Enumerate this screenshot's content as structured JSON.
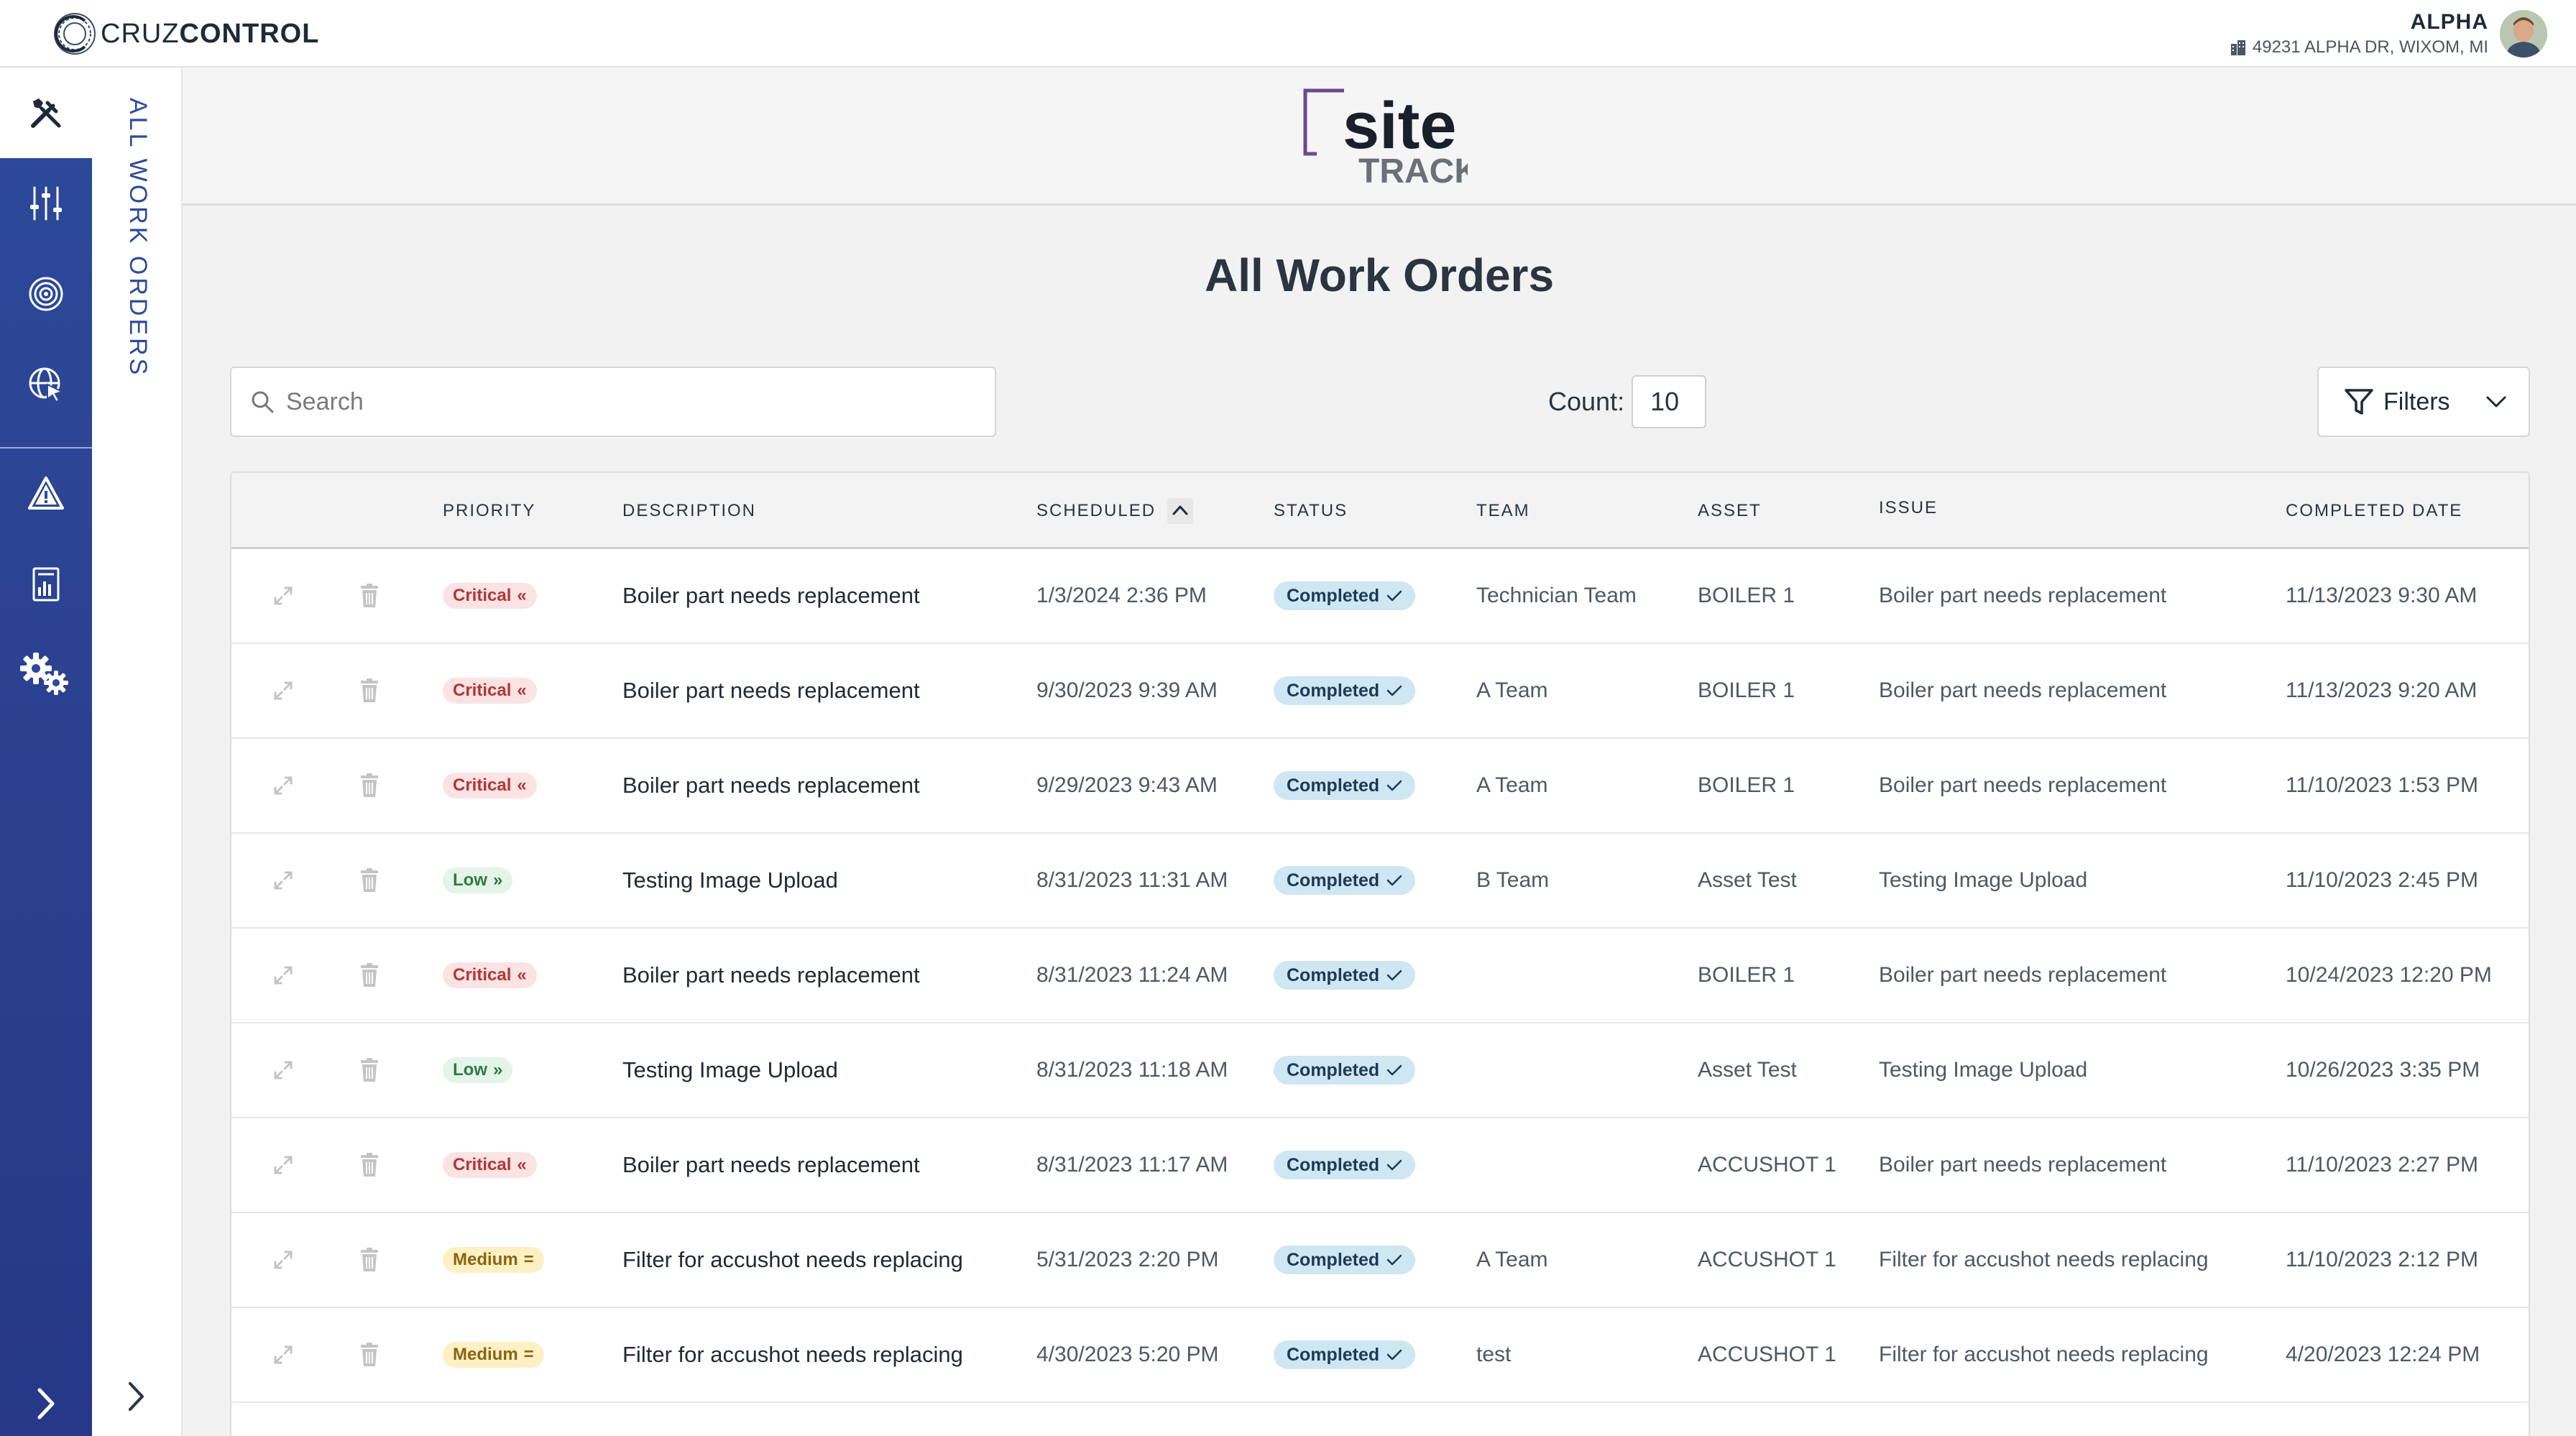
{
  "topbar": {
    "brand_light": "CRUZ",
    "brand_bold": "CONTROL",
    "user_name": "ALPHA",
    "user_address": "49231 ALPHA DR, WIXOM, MI"
  },
  "sidebar": {
    "items": [
      {
        "icon": "tools-icon",
        "active": true
      },
      {
        "icon": "sliders-icon",
        "active": false
      },
      {
        "icon": "target-icon",
        "active": false
      },
      {
        "icon": "globe-cursor-icon",
        "active": false
      },
      {
        "icon": "warning-icon",
        "active": false
      },
      {
        "icon": "report-icon",
        "active": false
      },
      {
        "icon": "gears-icon",
        "active": false
      }
    ]
  },
  "subnav": {
    "label": "ALL WORK ORDERS"
  },
  "logo": {
    "line1": "site",
    "line2": "TRACK"
  },
  "page": {
    "title": "All Work Orders"
  },
  "toolbar": {
    "search_placeholder": "Search",
    "count_label": "Count:",
    "count_value": "10",
    "filters_label": "Filters"
  },
  "table": {
    "columns": {
      "priority": "PRIORITY",
      "description": "DESCRIPTION",
      "scheduled": "SCHEDULED",
      "status": "STATUS",
      "team": "TEAM",
      "asset": "ASSET",
      "issue": "ISSUE",
      "completed": "COMPLETED DATE"
    },
    "rows": [
      {
        "priority": "Critical",
        "priority_symbol": "«",
        "description": "Boiler part needs replacement",
        "scheduled": "1/3/2024 2:36 PM",
        "status": "Completed",
        "team": "Technician Team",
        "asset": "BOILER 1",
        "issue": "Boiler part needs replacement",
        "completed": "11/13/2023 9:30 AM"
      },
      {
        "priority": "Critical",
        "priority_symbol": "«",
        "description": "Boiler part needs replacement",
        "scheduled": "9/30/2023 9:39 AM",
        "status": "Completed",
        "team": "A Team",
        "asset": "BOILER 1",
        "issue": "Boiler part needs replacement",
        "completed": "11/13/2023 9:20 AM"
      },
      {
        "priority": "Critical",
        "priority_symbol": "«",
        "description": "Boiler part needs replacement",
        "scheduled": "9/29/2023 9:43 AM",
        "status": "Completed",
        "team": "A Team",
        "asset": "BOILER 1",
        "issue": "Boiler part needs replacement",
        "completed": "11/10/2023 1:53 PM"
      },
      {
        "priority": "Low",
        "priority_symbol": "»",
        "description": "Testing Image Upload",
        "scheduled": "8/31/2023 11:31 AM",
        "status": "Completed",
        "team": "B Team",
        "asset": "Asset Test",
        "issue": "Testing Image Upload",
        "completed": "11/10/2023 2:45 PM"
      },
      {
        "priority": "Critical",
        "priority_symbol": "«",
        "description": "Boiler part needs replacement",
        "scheduled": "8/31/2023 11:24 AM",
        "status": "Completed",
        "team": "",
        "asset": "BOILER 1",
        "issue": "Boiler part needs replacement",
        "completed": "10/24/2023 12:20 PM"
      },
      {
        "priority": "Low",
        "priority_symbol": "»",
        "description": "Testing Image Upload",
        "scheduled": "8/31/2023 11:18 AM",
        "status": "Completed",
        "team": "",
        "asset": "Asset Test",
        "issue": "Testing Image Upload",
        "completed": "10/26/2023 3:35 PM"
      },
      {
        "priority": "Critical",
        "priority_symbol": "«",
        "description": "Boiler part needs replacement",
        "scheduled": "8/31/2023 11:17 AM",
        "status": "Completed",
        "team": "",
        "asset": "ACCUSHOT 1",
        "issue": "Boiler part needs replacement",
        "completed": "11/10/2023 2:27 PM"
      },
      {
        "priority": "Medium",
        "priority_symbol": "=",
        "description": "Filter for accushot needs replacing",
        "scheduled": "5/31/2023 2:20 PM",
        "status": "Completed",
        "team": "A Team",
        "asset": "ACCUSHOT 1",
        "issue": "Filter for accushot needs replacing",
        "completed": "11/10/2023 2:12 PM"
      },
      {
        "priority": "Medium",
        "priority_symbol": "=",
        "description": "Filter for accushot needs replacing",
        "scheduled": "4/30/2023 5:20 PM",
        "status": "Completed",
        "team": "test",
        "asset": "ACCUSHOT 1",
        "issue": "Filter for accushot needs replacing",
        "completed": "4/20/2023 12:24 PM"
      }
    ]
  },
  "colors": {
    "sidebar": "#2d4a9a",
    "critical_bg": "#fbe3e3",
    "low_bg": "#e4f4e8",
    "medium_bg": "#fdf0c4",
    "status_bg": "#cfe6f3",
    "logo_accent": "#6b4a8e"
  }
}
